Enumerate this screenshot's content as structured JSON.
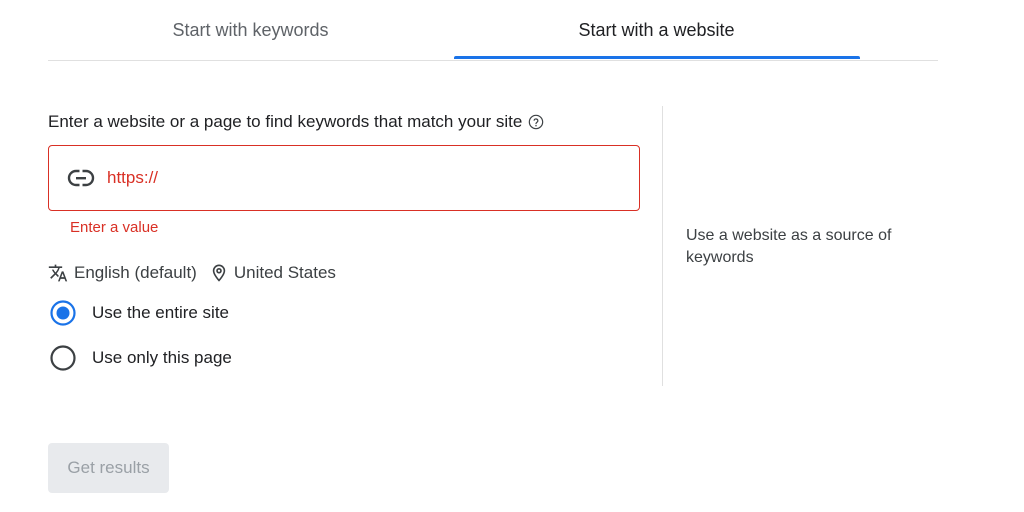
{
  "tabs": [
    {
      "label": "Start with keywords",
      "selected": false
    },
    {
      "label": "Start with a website",
      "selected": true
    }
  ],
  "form": {
    "prompt": "Enter a website or a page to find keywords that match your site",
    "help_icon": "help-circle-icon",
    "url_value": "https://",
    "error": "Enter a value",
    "language": "English (default)",
    "location": "United States",
    "scope_options": [
      {
        "label": "Use the entire site",
        "selected": true
      },
      {
        "label": "Use only this page",
        "selected": false
      }
    ],
    "submit_label": "Get results",
    "submit_enabled": false
  },
  "side_note": "Use a website as a source of keywords",
  "colors": {
    "accent": "#1a73e8",
    "error": "#d93025",
    "disabled_bg": "#e8eaed",
    "disabled_text": "#9aa0a6"
  }
}
